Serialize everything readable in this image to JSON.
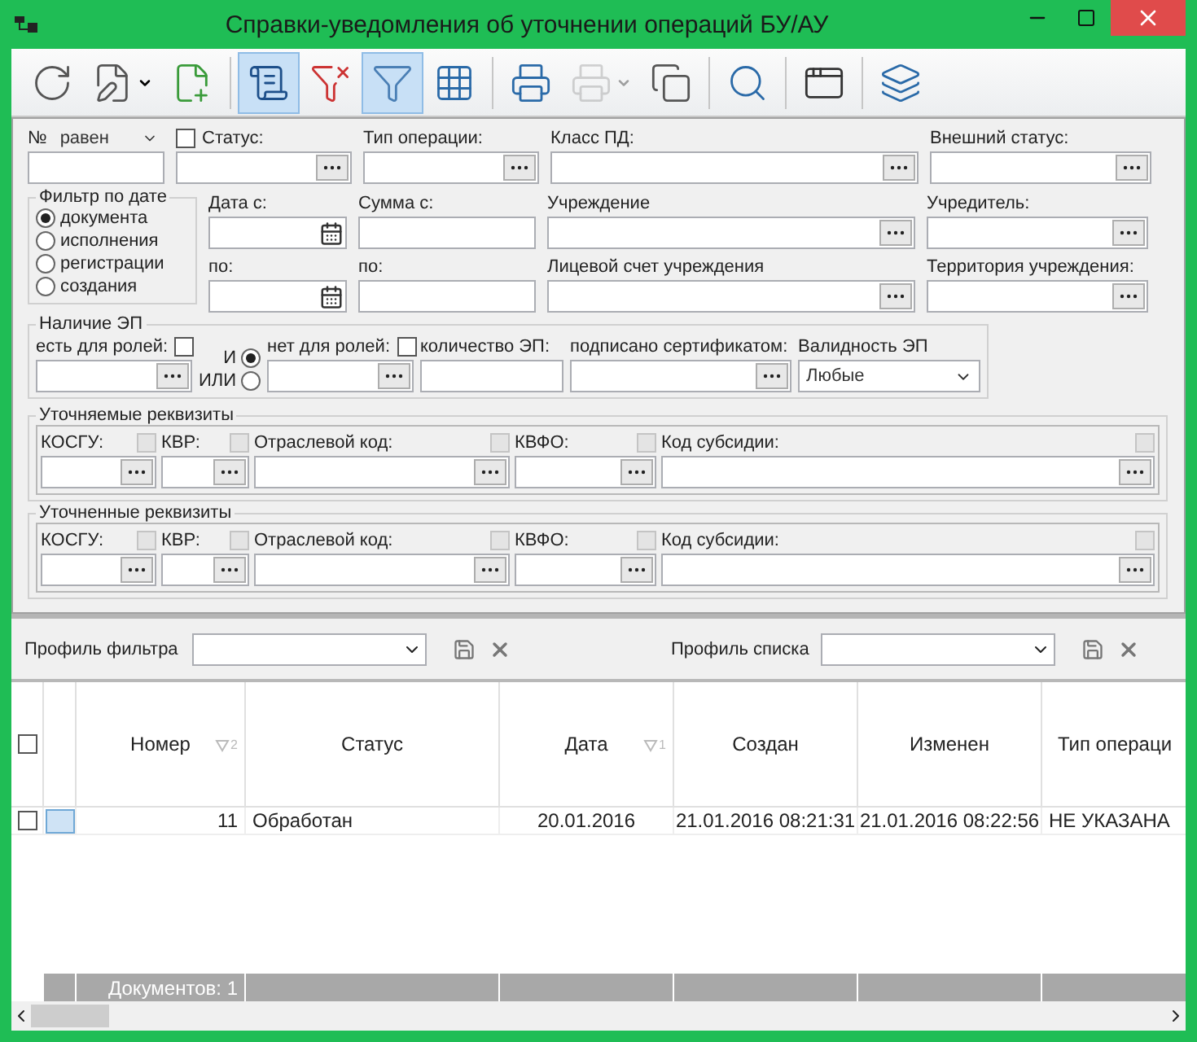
{
  "window": {
    "title": "Справки-уведомления об уточнении операций БУ/АУ"
  },
  "toolbar": [
    [
      {
        "selected": false,
        "disabled": false,
        "menu": false
      },
      {
        "selected": false,
        "disabled": false,
        "menu": true
      },
      {
        "selected": false,
        "disabled": false,
        "menu": false
      }
    ],
    [
      {
        "selected": true,
        "disabled": false,
        "menu": false
      },
      {
        "selected": false,
        "disabled": false,
        "menu": false
      },
      {
        "selected": true,
        "disabled": false,
        "menu": false
      },
      {
        "selected": false,
        "disabled": false,
        "menu": false
      }
    ],
    [
      {
        "selected": false,
        "disabled": false,
        "menu": false
      },
      {
        "selected": false,
        "disabled": true,
        "menu": true
      },
      {
        "selected": false,
        "disabled": false,
        "menu": false
      }
    ],
    [
      {
        "selected": false,
        "disabled": false,
        "menu": false
      }
    ],
    [
      {
        "selected": false,
        "disabled": false,
        "menu": false
      }
    ],
    [
      {
        "selected": false,
        "disabled": false,
        "menu": false
      }
    ]
  ],
  "filter": {
    "number": {
      "label": "№",
      "operator": "равен"
    },
    "status": {
      "label": "Статус:",
      "checked": false
    },
    "top_fields": [
      {
        "label": "Тип операции:"
      },
      {
        "label": "Класс ПД:"
      },
      {
        "label": "Внешний статус:"
      }
    ],
    "date_filter": {
      "title": "Фильтр по дате",
      "options": [
        {
          "label": "документа",
          "selected": true
        },
        {
          "label": "исполнения",
          "selected": false
        },
        {
          "label": "регистрации",
          "selected": false
        },
        {
          "label": "создания",
          "selected": false
        }
      ]
    },
    "rows": [
      [
        {
          "label": "Дата с:",
          "kind": "date"
        },
        {
          "label": "Сумма с:",
          "kind": "text"
        },
        {
          "label": "Учреждение",
          "kind": "lookup"
        },
        {
          "label": "Учредитель:",
          "kind": "lookup"
        }
      ],
      [
        {
          "label": "по:",
          "kind": "date"
        },
        {
          "label": "по:",
          "kind": "text"
        },
        {
          "label": "Лицевой счет учреждения",
          "kind": "lookup"
        },
        {
          "label": "Территория учреждения:",
          "kind": "lookup"
        }
      ]
    ],
    "signature": {
      "title": "Наличие ЭП",
      "roles_with": {
        "label": "есть для ролей:",
        "checked": false
      },
      "logic": [
        {
          "label": "И",
          "selected": true
        },
        {
          "label": "ИЛИ",
          "selected": false
        }
      ],
      "roles_without": {
        "label": "нет для ролей:",
        "checked": false
      },
      "count": {
        "label": "количество ЭП:"
      },
      "certificate": {
        "label": "подписано сертификатом:"
      },
      "validity": {
        "label": "Валидность ЭП",
        "value": "Любые"
      }
    },
    "sections": [
      {
        "title": "Уточняемые реквизиты",
        "fields": [
          {
            "label": "КОСГУ:",
            "checked": false,
            "disabled": true
          },
          {
            "label": "КВР:",
            "checked": false,
            "disabled": true
          },
          {
            "label": "Отраслевой код:",
            "checked": false,
            "disabled": true
          },
          {
            "label": "КВФО:",
            "checked": false,
            "disabled": true
          },
          {
            "label": "Код субсидии:",
            "checked": false,
            "disabled": true
          }
        ]
      },
      {
        "title": "Уточненные реквизиты",
        "fields": [
          {
            "label": "КОСГУ:",
            "checked": false,
            "disabled": true
          },
          {
            "label": "КВР:",
            "checked": false,
            "disabled": true
          },
          {
            "label": "Отраслевой код:",
            "checked": false,
            "disabled": true
          },
          {
            "label": "КВФО:",
            "checked": false,
            "disabled": true
          },
          {
            "label": "Код субсидии:",
            "checked": false,
            "disabled": true
          }
        ]
      }
    ]
  },
  "profiles": [
    {
      "label": "Профиль фильтра"
    },
    {
      "label": "Профиль списка"
    }
  ],
  "table": {
    "select_all": {
      "checked": false
    },
    "columns": [
      {
        "label": "Номер",
        "sort": "2"
      },
      {
        "label": "Статус"
      },
      {
        "label": "Дата",
        "sort": "1"
      },
      {
        "label": "Создан"
      },
      {
        "label": "Изменен"
      },
      {
        "label": "Тип операци"
      }
    ],
    "rows": [
      {
        "checked": false,
        "current": true,
        "cells": [
          "11",
          "Обработан",
          "20.01.2016",
          "21.01.2016 08:21:31",
          "21.01.2016 08:22:56",
          "НЕ УКАЗАНА"
        ]
      }
    ],
    "footer": "Документов: 1"
  }
}
